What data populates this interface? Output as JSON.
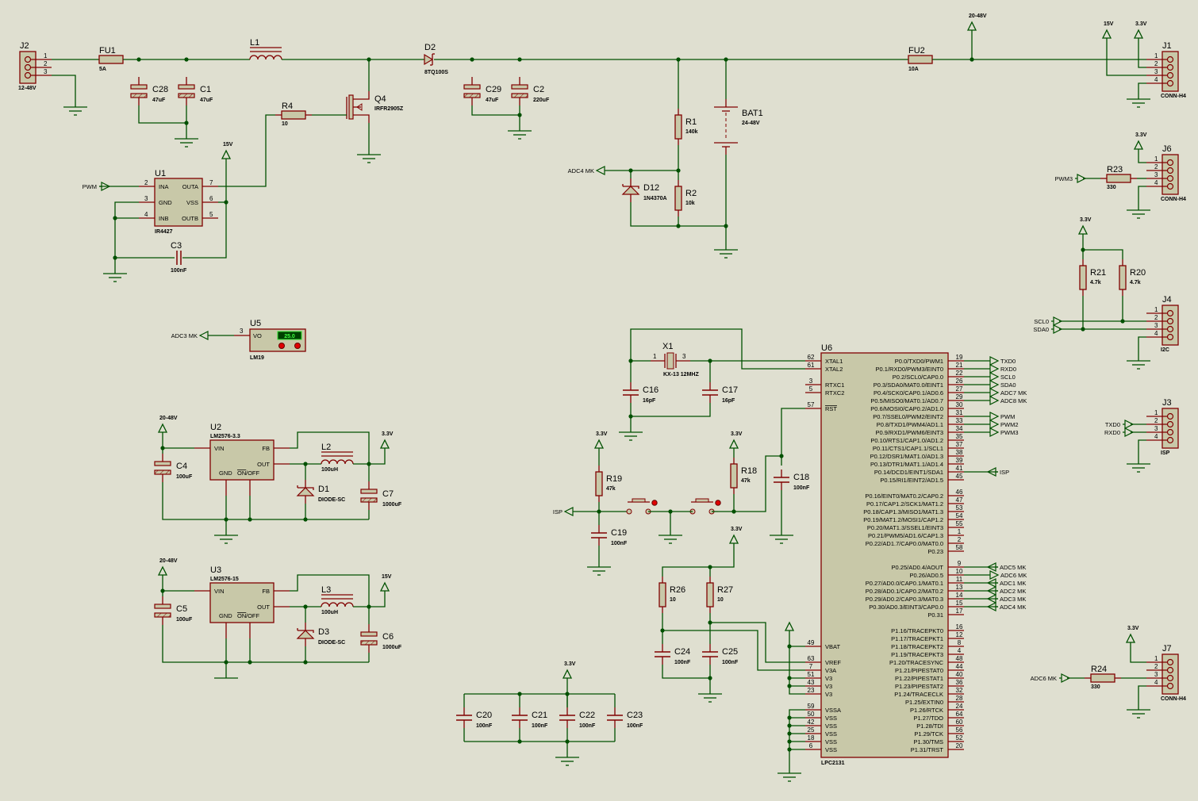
{
  "power": {
    "v33": "3.3V",
    "v15": "15V",
    "v2048": "20-48V"
  },
  "c": {
    "J2": {
      "ref": "J2",
      "value": "12-48V",
      "pins": [
        "1",
        "2",
        "3"
      ]
    },
    "FU1": {
      "ref": "FU1",
      "value": "5A"
    },
    "L1": {
      "ref": "L1"
    },
    "C28": {
      "ref": "C28",
      "value": "47uF"
    },
    "C1": {
      "ref": "C1",
      "value": "47uF"
    },
    "Q4": {
      "ref": "Q4",
      "value": "IRFR2905Z"
    },
    "R4": {
      "ref": "R4",
      "value": "10"
    },
    "U1": {
      "ref": "U1",
      "value": "IR4427",
      "left": [
        {
          "pin": "2",
          "name": "INA"
        },
        {
          "pin": "3",
          "name": "GND"
        },
        {
          "pin": "4",
          "name": "INB"
        }
      ],
      "right": [
        {
          "pin": "7",
          "name": "OUTA"
        },
        {
          "pin": "6",
          "name": "VSS"
        },
        {
          "pin": "5",
          "name": "OUTB"
        }
      ]
    },
    "C3": {
      "ref": "C3",
      "value": "100nF"
    },
    "D2": {
      "ref": "D2",
      "value": "8TQ100S"
    },
    "C29": {
      "ref": "C29",
      "value": "47uF"
    },
    "C2": {
      "ref": "C2",
      "value": "220uF"
    },
    "R1": {
      "ref": "R1",
      "value": "140k"
    },
    "R2": {
      "ref": "R2",
      "value": "10k"
    },
    "D12": {
      "ref": "D12",
      "value": "1N4370A"
    },
    "BAT1": {
      "ref": "BAT1",
      "value": "24-48V"
    },
    "FU2": {
      "ref": "FU2",
      "value": "10A"
    },
    "J1": {
      "ref": "J1",
      "value": "CONN-H4",
      "pins": [
        "1",
        "2",
        "3",
        "4"
      ]
    },
    "J6": {
      "ref": "J6",
      "value": "CONN-H4",
      "pins": [
        "1",
        "2",
        "3",
        "4"
      ]
    },
    "R23": {
      "ref": "R23",
      "value": "330"
    },
    "R21": {
      "ref": "R21",
      "value": "4.7k"
    },
    "R20": {
      "ref": "R20",
      "value": "4.7k"
    },
    "J4": {
      "ref": "J4",
      "value": "I2C",
      "pins": [
        "1",
        "2",
        "3",
        "4"
      ]
    },
    "J3": {
      "ref": "J3",
      "value": "ISP",
      "pins": [
        "1",
        "2",
        "3",
        "4"
      ]
    },
    "J7": {
      "ref": "J7",
      "value": "CONN-H4",
      "pins": [
        "1",
        "2",
        "3",
        "4"
      ]
    },
    "R24": {
      "ref": "R24",
      "value": "330"
    },
    "U5": {
      "ref": "U5",
      "value": "LM19",
      "pin": "3",
      "pin_name": "VO",
      "display": "25.0"
    },
    "U2": {
      "ref": "U2",
      "value": "LM2576-3.3"
    },
    "U3": {
      "ref": "U3",
      "value": "LM2576-15"
    },
    "reg_pins": {
      "vin": "VIN",
      "fb": "FB",
      "out": "OUT",
      "gnd": "GND",
      "on": "ON",
      "off": "/OFF"
    },
    "C4": {
      "ref": "C4",
      "value": "100uF"
    },
    "L2": {
      "ref": "L2",
      "value": "100uH"
    },
    "D1": {
      "ref": "D1",
      "value": "DIODE-SC"
    },
    "C7": {
      "ref": "C7",
      "value": "1000uF"
    },
    "C5": {
      "ref": "C5",
      "value": "100uF"
    },
    "L3": {
      "ref": "L3",
      "value": "100uH"
    },
    "D3": {
      "ref": "D3",
      "value": "DIODE-SC"
    },
    "C6": {
      "ref": "C6",
      "value": "1000uF"
    },
    "X1": {
      "ref": "X1",
      "value": "KX-13 12MHZ",
      "pins": [
        "1",
        "3"
      ]
    },
    "C16": {
      "ref": "C16",
      "value": "16pF"
    },
    "C17": {
      "ref": "C17",
      "value": "16pF"
    },
    "R19": {
      "ref": "R19",
      "value": "47k"
    },
    "R18": {
      "ref": "R18",
      "value": "47k"
    },
    "C19": {
      "ref": "C19",
      "value": "100nF"
    },
    "C18": {
      "ref": "C18",
      "value": "100nF"
    },
    "R26": {
      "ref": "R26",
      "value": "10"
    },
    "R27": {
      "ref": "R27",
      "value": "10"
    },
    "C24": {
      "ref": "C24",
      "value": "100nF"
    },
    "C25": {
      "ref": "C25",
      "value": "100nF"
    },
    "C20": {
      "ref": "C20",
      "value": "100nF"
    },
    "C21": {
      "ref": "C21",
      "value": "100nF"
    },
    "C22": {
      "ref": "C22",
      "value": "100nF"
    },
    "C23": {
      "ref": "C23",
      "value": "100nF"
    }
  },
  "nets": {
    "pwm": "PWM",
    "pwm3": "PWM3",
    "adc4": "ADC4 MK",
    "adc3": "ADC3 MK",
    "adc6": "ADC6 MK",
    "scl0": "SCL0",
    "sda0": "SDA0",
    "txd0": "TXD0",
    "rxd0": "RXD0",
    "isp": "ISP"
  },
  "u6": {
    "ref": "U6",
    "part": "LPC2131",
    "left": [
      {
        "pin": "62",
        "name": "XTAL1"
      },
      {
        "pin": "61",
        "name": "XTAL2"
      },
      {
        "pin": "3",
        "name": "RTXC1"
      },
      {
        "pin": "5",
        "name": "RTXC2"
      },
      {
        "pin": "57",
        "name": "RST"
      },
      {
        "pin": "49",
        "name": "VBAT"
      },
      {
        "pin": "63",
        "name": "VREF"
      },
      {
        "pin": "7",
        "name": "V3A"
      },
      {
        "pin": "51",
        "name": "V3"
      },
      {
        "pin": "43",
        "name": "V3"
      },
      {
        "pin": "23",
        "name": "V3"
      },
      {
        "pin": "59",
        "name": "VSSA"
      },
      {
        "pin": "50",
        "name": "VSS"
      },
      {
        "pin": "42",
        "name": "VSS"
      },
      {
        "pin": "25",
        "name": "VSS"
      },
      {
        "pin": "18",
        "name": "VSS"
      },
      {
        "pin": "6",
        "name": "VSS"
      }
    ],
    "right": [
      {
        "pin": "19",
        "name": "P0.0/TXD0/PWM1",
        "net": "TXD0",
        "dir": "out"
      },
      {
        "pin": "21",
        "name": "P0.1/RXD0/PWM3/EINT0",
        "net": "RXD0",
        "dir": "out"
      },
      {
        "pin": "22",
        "name": "P0.2/SCL0/CAP0.0",
        "net": "SCL0",
        "dir": "out"
      },
      {
        "pin": "26",
        "name": "P0.3/SDA0/MAT0.0/EINT1",
        "net": "SDA0",
        "dir": "out"
      },
      {
        "pin": "27",
        "name": "P0.4/SCK0/CAP0.1/AD0.6",
        "net": "ADC7 MK",
        "dir": "out"
      },
      {
        "pin": "29",
        "name": "P0.5/MISO0/MAT0.1/AD0.7",
        "net": "ADC8 MK",
        "dir": "out"
      },
      {
        "pin": "30",
        "name": "P0.6/MOSI0/CAP0.2/AD1.0"
      },
      {
        "pin": "31",
        "name": "P0.7/SSEL0/PWM2/EINT2",
        "net": "PWM",
        "dir": "out"
      },
      {
        "pin": "33",
        "name": "P0.8/TXD1/PWM4/AD1.1",
        "net": "PWM2",
        "dir": "out"
      },
      {
        "pin": "34",
        "name": "P0.9/RXD1/PWM6/EINT3",
        "net": "PWM3",
        "dir": "out"
      },
      {
        "pin": "35",
        "name": "P0.10/RTS1/CAP1.0/AD1.2"
      },
      {
        "pin": "37",
        "name": "P0.11/CTS1/CAP1.1/SCL1"
      },
      {
        "pin": "38",
        "name": "P0.12/DSR1/MAT1.0/AD1.3"
      },
      {
        "pin": "39",
        "name": "P0.13/DTR1/MAT1.1/AD1.4"
      },
      {
        "pin": "41",
        "name": "P0.14/DCD1/EINT1/SDA1",
        "net": "ISP",
        "dir": "in"
      },
      {
        "pin": "45",
        "name": "P0.15/RI1/EINT2/AD1.5"
      },
      {
        "pin": "46",
        "name": "P0.16/EINT0/MAT0.2/CAP0.2"
      },
      {
        "pin": "47",
        "name": "P0.17/CAP1.2/SCK1/MAT1.2"
      },
      {
        "pin": "53",
        "name": "P0.18/CAP1.3/MISO1/MAT1.3"
      },
      {
        "pin": "54",
        "name": "P0.19/MAT1.2/MOSI1/CAP1.2"
      },
      {
        "pin": "55",
        "name": "P0.20/MAT1.3/SSEL1/EINT3"
      },
      {
        "pin": "1",
        "name": "P0.21/PWM5/AD1.6/CAP1.3"
      },
      {
        "pin": "2",
        "name": "P0.22/AD1.7/CAP0.0/MAT0.0"
      },
      {
        "pin": "58",
        "name": "P0.23"
      },
      {
        "pin": "9",
        "name": "P0.25/AD0.4/AOUT",
        "net": "ADC5 MK",
        "dir": "in"
      },
      {
        "pin": "10",
        "name": "P0.26/AD0.5",
        "net": "ADC6 MK",
        "dir": "out"
      },
      {
        "pin": "11",
        "name": "P0.27/AD0.0/CAP0.1/MAT0.1",
        "net": "ADC1 MK",
        "dir": "in"
      },
      {
        "pin": "13",
        "name": "P0.28/AD0.1/CAP0.2/MAT0.2",
        "net": "ADC2 MK",
        "dir": "in"
      },
      {
        "pin": "14",
        "name": "P0.29/AD0.2/CAP0.3/MAT0.3",
        "net": "ADC3 MK",
        "dir": "in"
      },
      {
        "pin": "15",
        "name": "P0.30/AD0.3/EINT3/CAP0.0",
        "net": "ADC4 MK",
        "dir": "in"
      },
      {
        "pin": "17",
        "name": "P0.31"
      },
      {
        "pin": "16",
        "name": "P1.16/TRACEPKT0"
      },
      {
        "pin": "12",
        "name": "P1.17/TRACEPKT1"
      },
      {
        "pin": "8",
        "name": "P1.18/TRACEPKT2"
      },
      {
        "pin": "4",
        "name": "P1.19/TRACEPKT3"
      },
      {
        "pin": "48",
        "name": "P1.20/TRACESYNC"
      },
      {
        "pin": "44",
        "name": "P1.21/PIPESTAT0"
      },
      {
        "pin": "40",
        "name": "P1.22/PIPESTAT1"
      },
      {
        "pin": "36",
        "name": "P1.23/PIPESTAT2"
      },
      {
        "pin": "32",
        "name": "P1.24/TRACECLK"
      },
      {
        "pin": "28",
        "name": "P1.25/EXTIN0"
      },
      {
        "pin": "24",
        "name": "P1.26/RTCK"
      },
      {
        "pin": "64",
        "name": "P1.27/TDO"
      },
      {
        "pin": "60",
        "name": "P1.28/TDI"
      },
      {
        "pin": "56",
        "name": "P1.29/TCK"
      },
      {
        "pin": "52",
        "name": "P1.30/TMS"
      },
      {
        "pin": "20",
        "name": "P1.31/TRST"
      }
    ]
  },
  "colors": {
    "background": "#dfdfd0",
    "wire": "#005000",
    "component": "#800000",
    "body": "#c8c8a8",
    "lcd": "#008000"
  }
}
